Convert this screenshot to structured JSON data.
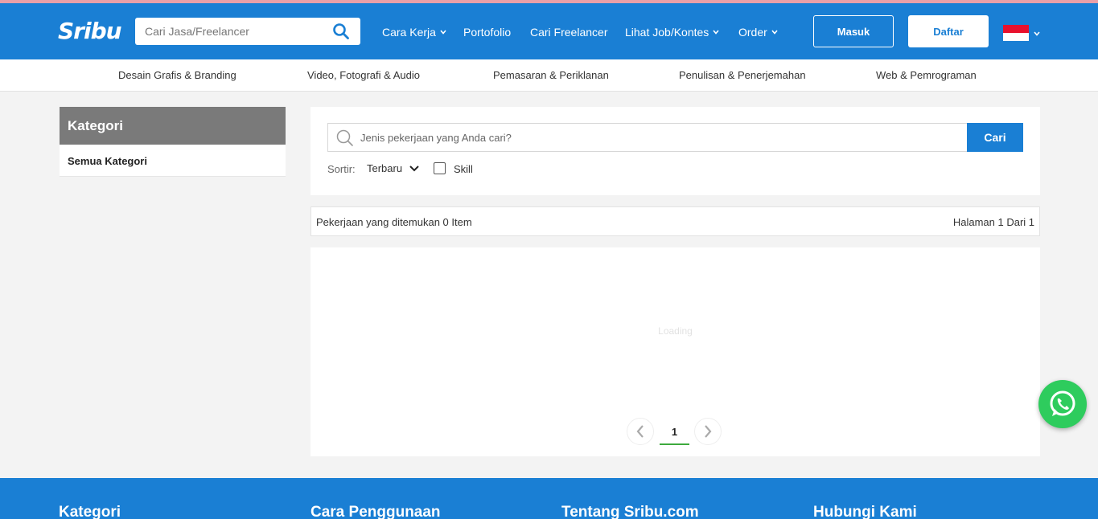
{
  "header": {
    "logo": "Sribu",
    "search_placeholder": "Cari Jasa/Freelancer",
    "nav": {
      "cara_kerja": "Cara Kerja",
      "portofolio": "Portofolio",
      "cari_freelancer": "Cari Freelancer",
      "lihat_job": "Lihat Job/Kontes",
      "order": "Order"
    },
    "login": "Masuk",
    "register": "Daftar"
  },
  "categories": [
    "Desain Grafis & Branding",
    "Video, Fotografi & Audio",
    "Pemasaran & Periklanan",
    "Penulisan & Penerjemahan",
    "Web & Pemrograman"
  ],
  "sidebar": {
    "title": "Kategori",
    "items": [
      "Semua Kategori"
    ]
  },
  "job_search": {
    "placeholder": "Jenis pekerjaan yang Anda cari?",
    "button": "Cari",
    "sort_label": "Sortir:",
    "sort_value": "Terbaru",
    "skill_label": "Skill"
  },
  "results": {
    "found": "Pekerjaan yang ditemukan 0 Item",
    "page": "Halaman 1 Dari 1"
  },
  "content": {
    "loading": "Loading",
    "current_page": "1"
  },
  "footer": {
    "headings": [
      "Kategori",
      "Cara Penggunaan",
      "Tentang Sribu.com",
      "Hubungi Kami"
    ]
  },
  "colors": {
    "brand_blue": "#1a7fd4",
    "whatsapp_green": "#2ecc5d"
  }
}
